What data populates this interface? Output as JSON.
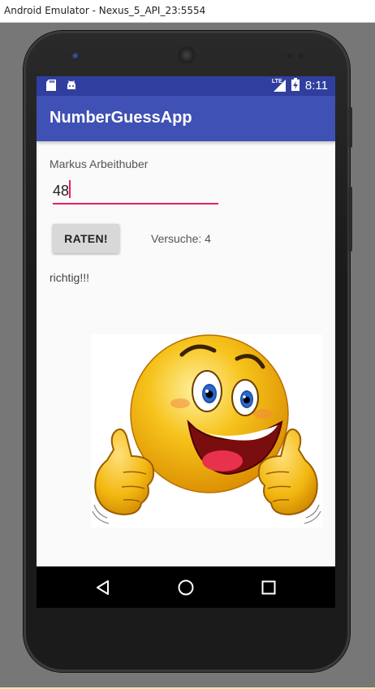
{
  "window": {
    "title": "Android Emulator - Nexus_5_API_23:5554"
  },
  "statusbar": {
    "network": "LTE",
    "time": "8:11"
  },
  "appbar": {
    "title": "NumberGuessApp"
  },
  "form": {
    "name_label": "Markus Arbeithuber",
    "guess_value": "48",
    "button_label": "RATEN!",
    "attempts_text": "Versuche: 4",
    "result_text": "richtig!!!"
  },
  "image": {
    "icon": "thumbs-up-smiley-icon"
  },
  "navbar": {
    "icons": [
      "back-icon",
      "home-icon",
      "recents-icon"
    ]
  },
  "colors": {
    "primary": "#3f51b5",
    "primary_dark": "#303f9f",
    "accent": "#e91e63"
  }
}
